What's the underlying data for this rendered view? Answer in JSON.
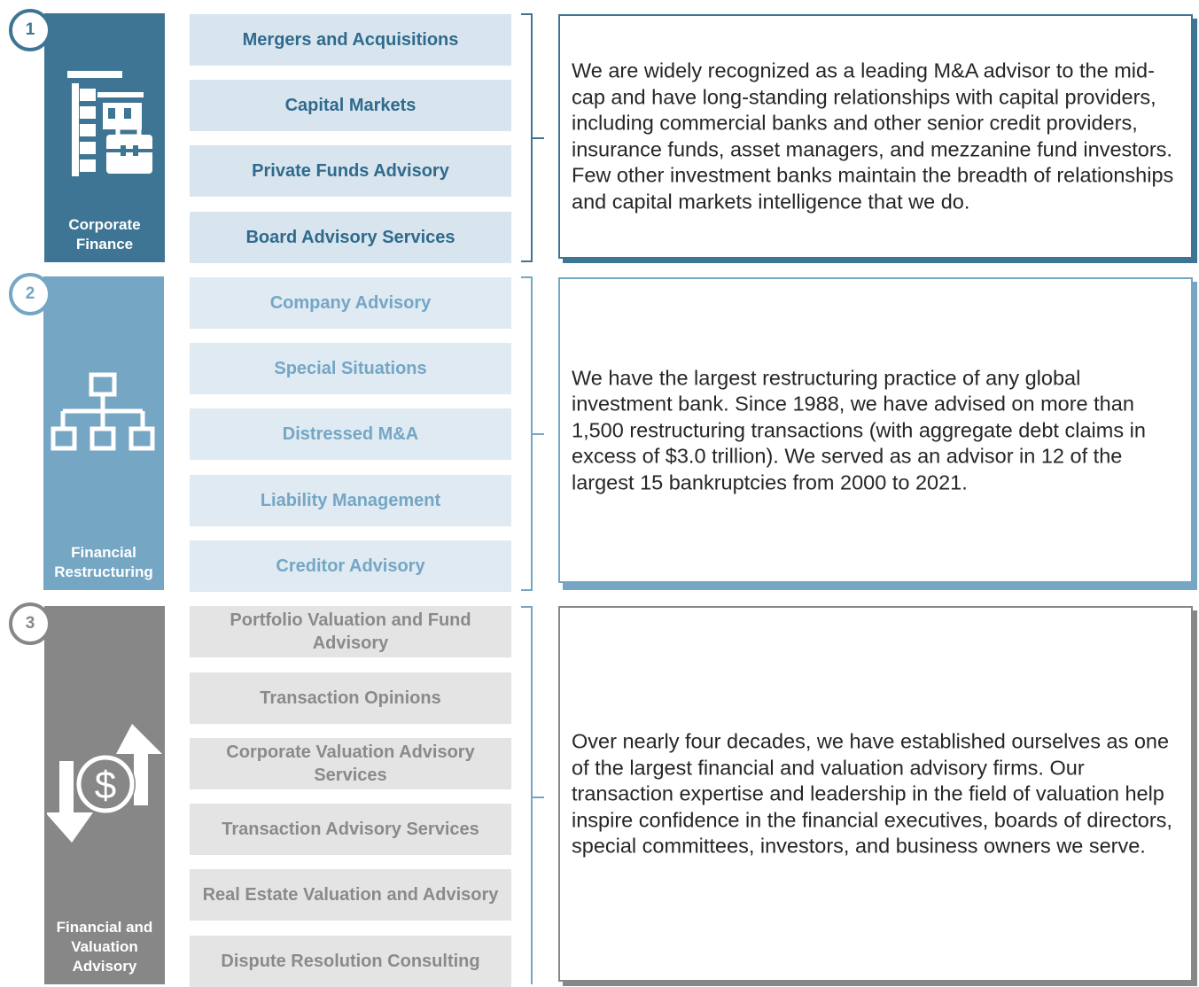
{
  "sections": [
    {
      "number": "1",
      "label": "Corporate\nFinance",
      "icon": "building-briefcase-icon",
      "color": "#3f7594",
      "services": [
        "Mergers and Acquisitions",
        "Capital Markets",
        "Private Funds Advisory",
        "Board Advisory Services"
      ],
      "description": "We are widely recognized as a leading M&A advisor to the mid-cap and have long-standing relationships with capital providers, including commercial banks and other senior credit providers, insurance funds, asset managers, and mezzanine fund investors. Few other investment banks maintain the breadth of relationships and capital markets intelligence that we do."
    },
    {
      "number": "2",
      "label": "Financial\nRestructuring",
      "icon": "org-chart-icon",
      "color": "#75a6c4",
      "services": [
        "Company Advisory",
        "Special Situations",
        "Distressed M&A",
        "Liability Management",
        "Creditor Advisory"
      ],
      "description": "We have the largest restructuring practice of any global investment bank. Since 1988, we have advised on more than 1,500 restructuring transactions (with aggregate debt claims in excess of $3.0 trillion). We served as an advisor in 12 of the largest 15 bankruptcies from 2000 to 2021."
    },
    {
      "number": "3",
      "label": "Financial and\nValuation\nAdvisory",
      "icon": "dollar-exchange-icon",
      "color": "#878787",
      "services": [
        "Portfolio Valuation and Fund Advisory",
        "Transaction Opinions",
        "Corporate Valuation Advisory Services",
        "Transaction Advisory Services",
        "Real Estate Valuation and Advisory",
        "Dispute Resolution Consulting"
      ],
      "description": "Over nearly four decades, we have established ourselves as one of the largest financial and valuation advisory firms. Our transaction expertise and leadership in the field of valuation help inspire confidence in the financial executives, boards of directors, special committees, investors, and business owners we serve."
    }
  ]
}
